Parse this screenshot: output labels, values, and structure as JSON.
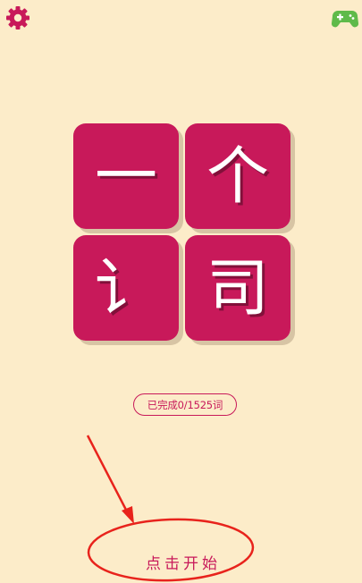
{
  "header": {
    "settings_icon": "gear-icon",
    "game_icon": "gamepad-icon"
  },
  "tiles": [
    {
      "char": "一"
    },
    {
      "char": "个"
    },
    {
      "char": "讠"
    },
    {
      "char": "司"
    }
  ],
  "progress": {
    "text": "已完成0/1525词"
  },
  "start": {
    "label": "点击开始"
  },
  "colors": {
    "background": "#fcecc9",
    "accent": "#c8195a",
    "game_icon": "#5fba4a",
    "annotation": "#e8231c"
  }
}
